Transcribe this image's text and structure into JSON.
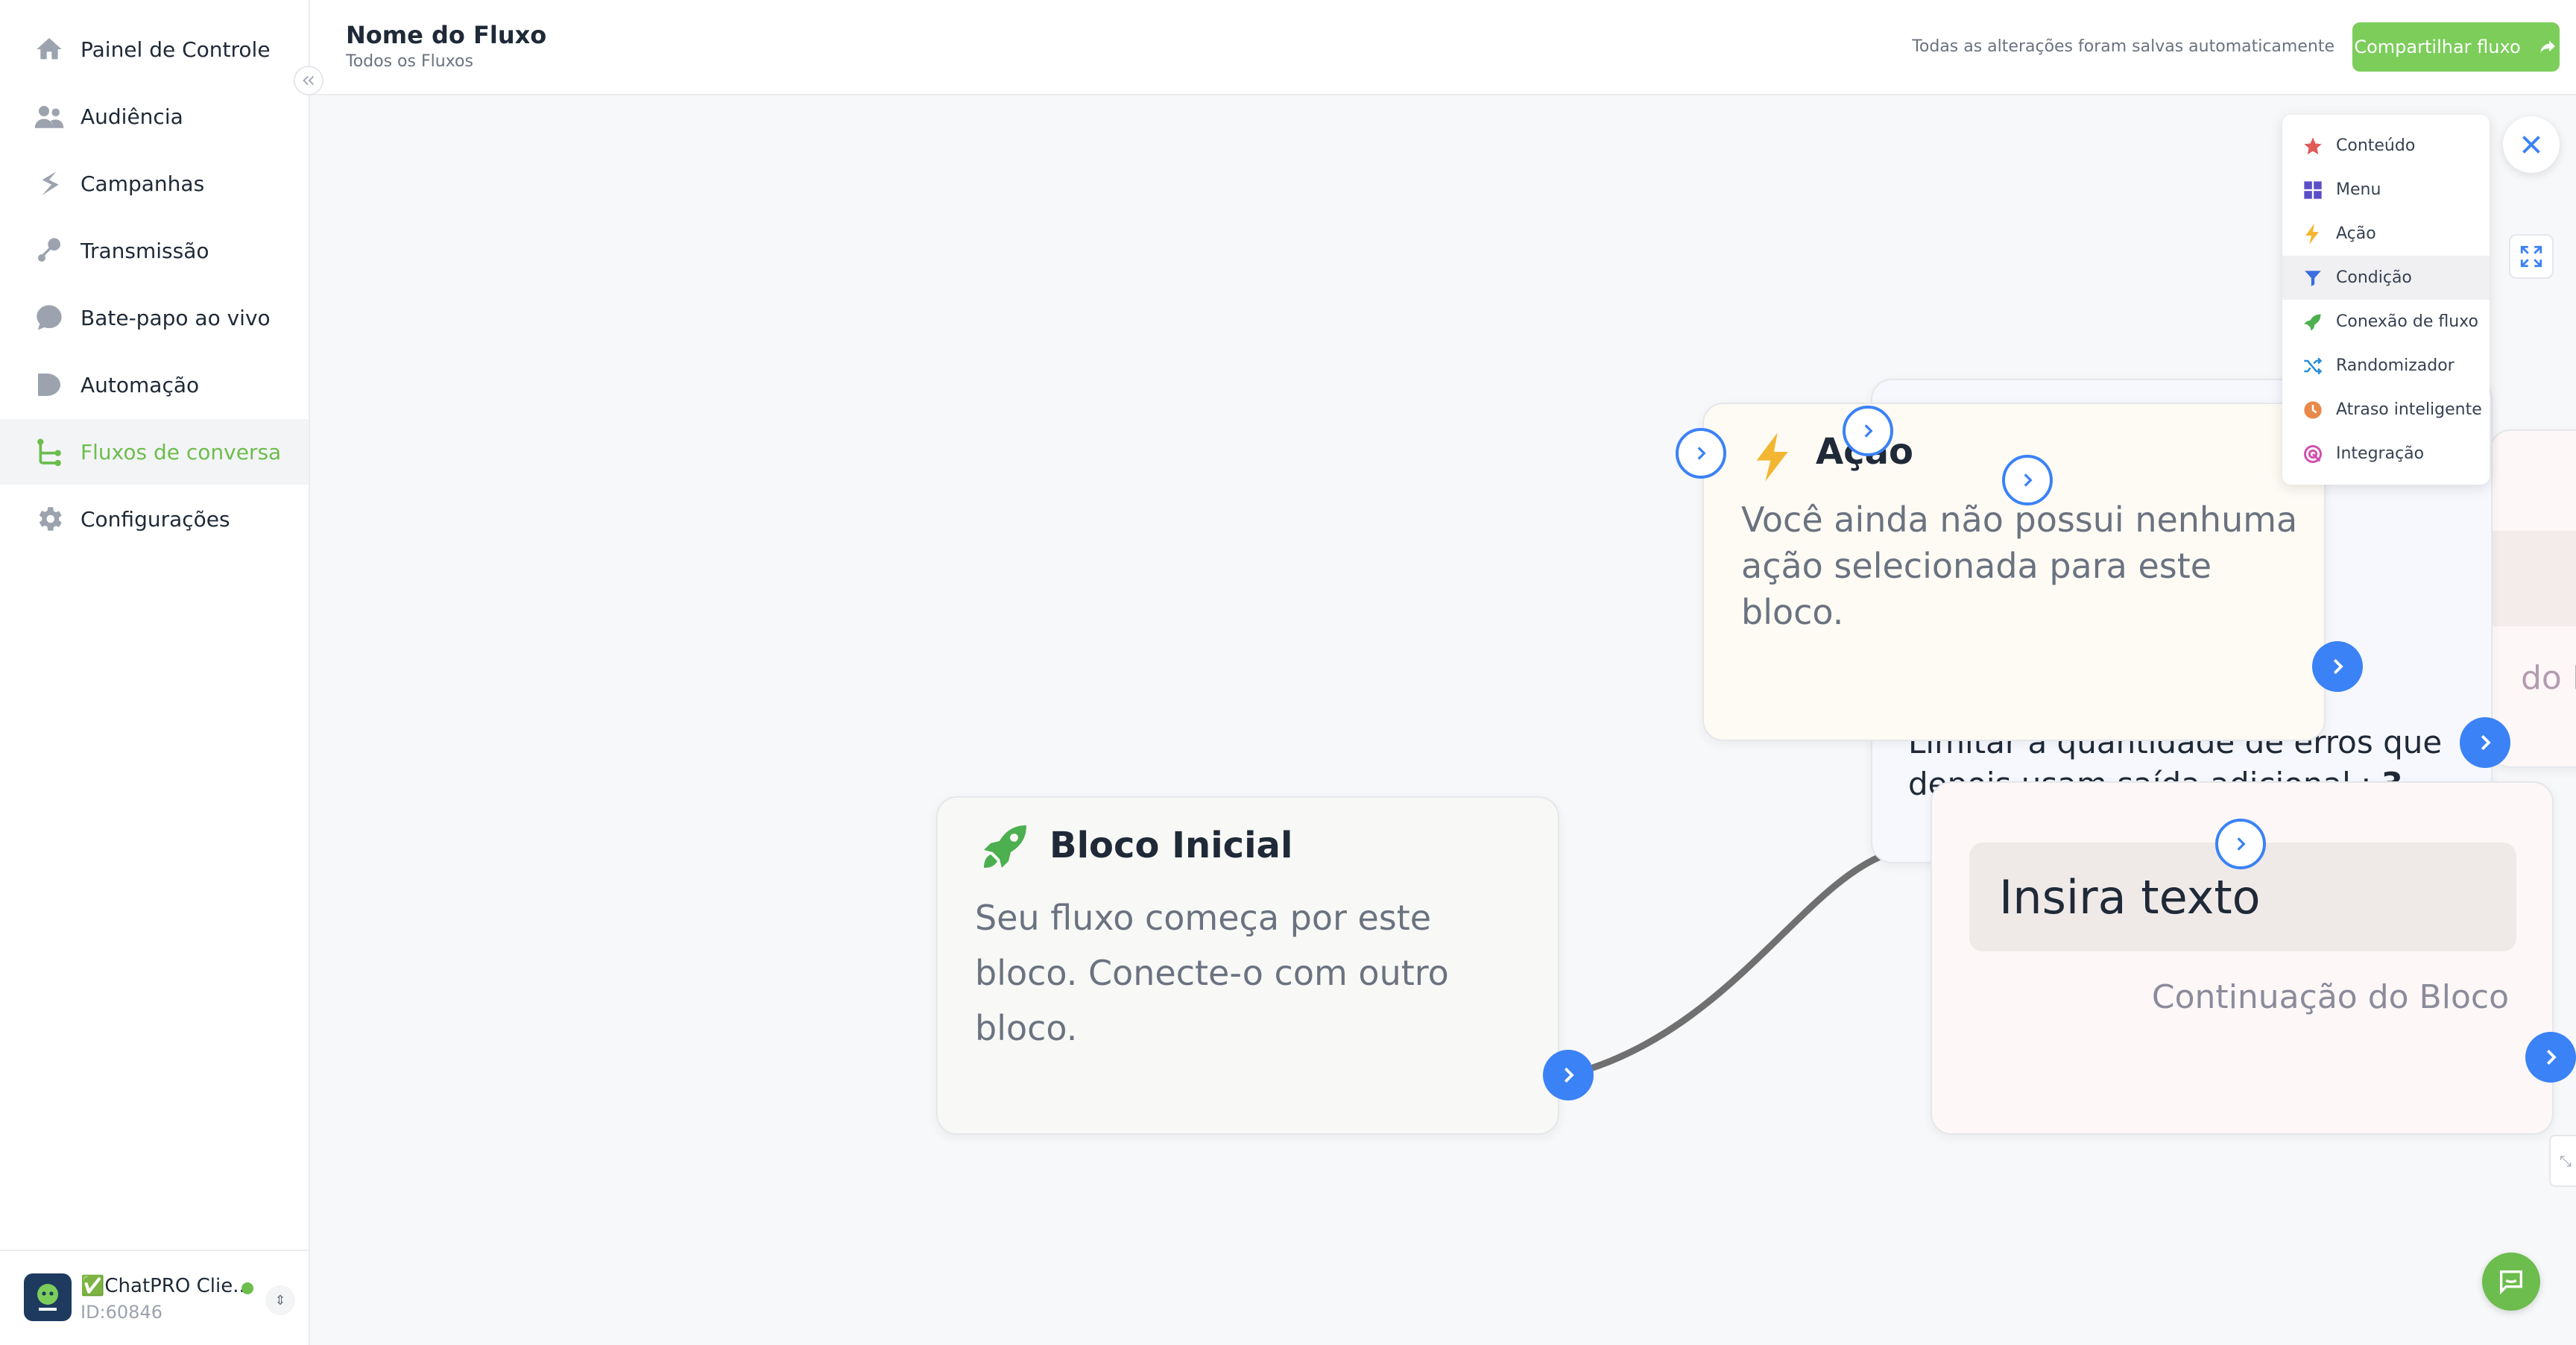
{
  "sidebar": {
    "items": [
      {
        "label": "Painel de Controle",
        "icon": "home-icon"
      },
      {
        "label": "Audiência",
        "icon": "users-icon"
      },
      {
        "label": "Campanhas",
        "icon": "campaign-icon"
      },
      {
        "label": "Transmissão",
        "icon": "broadcast-icon"
      },
      {
        "label": "Bate-papo ao vivo",
        "icon": "chat-bubble-icon"
      },
      {
        "label": "Automação",
        "icon": "automation-icon"
      },
      {
        "label": "Fluxos de conversa",
        "icon": "flow-icon",
        "active": true
      },
      {
        "label": "Configurações",
        "icon": "gear-icon"
      }
    ],
    "profile": {
      "name": "✅ChatPRO Clie...",
      "id": "ID:60846",
      "status_color": "#6cbd4d"
    }
  },
  "header": {
    "title": "Nome do Fluxo",
    "breadcrumb": "Todos os Fluxos",
    "saved_status": "Todas as alterações foram salvas automaticamente",
    "share_label": "Compartilhar fluxo",
    "accent_color": "#7ccd5a"
  },
  "canvas": {
    "start_block": {
      "title": "Bloco Inicial",
      "description": "Seu fluxo começa por este bloco. Conecte-o com outro bloco."
    },
    "action_block": {
      "title": "Ação",
      "description": "Você ainda não possui nenhuma ação selecionada para este bloco."
    },
    "condition_block": {
      "limit_text": "Limitar a quantidade de erros que depois usam saída adicional :",
      "limit_value": "3"
    },
    "content_block": {
      "input_placeholder": "Insira texto",
      "continuation_label": "Continuação do Bloco"
    },
    "right_block": {
      "continuation_label": "do Blo"
    }
  },
  "block_menu": {
    "items": [
      {
        "label": "Conteúdo",
        "icon": "star-icon",
        "color": "#e05a5a"
      },
      {
        "label": "Menu",
        "icon": "grid-icon",
        "color": "#5b4fc9"
      },
      {
        "label": "Ação",
        "icon": "lightning-icon",
        "color": "#f2b632"
      },
      {
        "label": "Condição",
        "icon": "filter-icon",
        "color": "#3b6fe0",
        "active": true
      },
      {
        "label": "Conexão de fluxo",
        "icon": "rocket-icon",
        "color": "#4caf50"
      },
      {
        "label": "Randomizador",
        "icon": "shuffle-icon",
        "color": "#2a8fd6"
      },
      {
        "label": "Atraso inteligente",
        "icon": "clock-icon",
        "color": "#e8894a"
      },
      {
        "label": "Integração",
        "icon": "integration-icon",
        "color": "#d04fae"
      }
    ]
  }
}
